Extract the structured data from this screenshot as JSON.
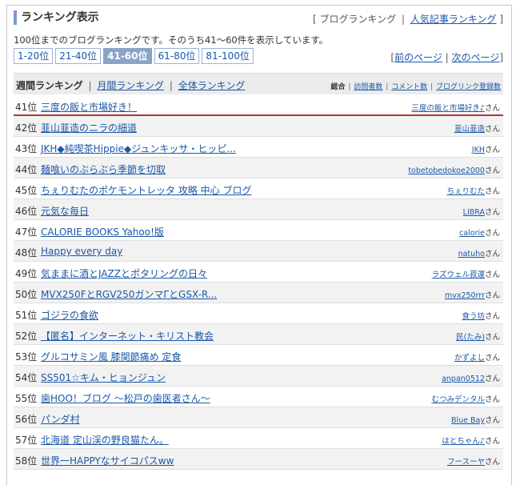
{
  "header": {
    "title": "ランキング表示",
    "bracket_open": "[",
    "blog_ranking": "ブログランキング",
    "sep": "|",
    "popular_ranking": "人気記事ランキング",
    "bracket_close": "]"
  },
  "description": "100位までのブログランキングです。そのうち41～60件を表示しています。",
  "ranges": [
    "1-20位",
    "21-40位",
    "41-60位",
    "61-80位",
    "81-100位"
  ],
  "pager": {
    "open": "[",
    "prev": "前のページ",
    "sep": "|",
    "next": "次のページ",
    "close": "]"
  },
  "period": {
    "weekly": "週間ランキング",
    "sep": "|",
    "monthly": "月間ランキング",
    "overall": "全体ランキング",
    "sort_total": "総合",
    "sort_visitors": "訪問者数",
    "sort_comments": "コメント数",
    "sort_registered": "ブログリンク登録数"
  },
  "suffix": "さん",
  "rows": [
    {
      "rank": "41位",
      "title": "三度の飯と市場好き！",
      "user": "三度の飯と市場好き♪"
    },
    {
      "rank": "42位",
      "title": "韮山韮造のニラの細道",
      "user": "韮山韮造"
    },
    {
      "rank": "43位",
      "title": "JKH◆純喫茶Hippie◆ジュンキッサ・ヒッピ...",
      "user": "JKH"
    },
    {
      "rank": "44位",
      "title": "麺喰いのぶらぶら季節を切取",
      "user": "tobetobedokoe2000"
    },
    {
      "rank": "45位",
      "title": "ちぇりむたのポケモントレッタ 攻略 中心 ブログ",
      "user": "ちぇりむた"
    },
    {
      "rank": "46位",
      "title": "元気な毎日",
      "user": "LIBRA"
    },
    {
      "rank": "47位",
      "title": "CALORIE BOOKS Yahoo!版",
      "user": "calorie"
    },
    {
      "rank": "48位",
      "title": "Happy every day",
      "user": "natuho"
    },
    {
      "rank": "49位",
      "title": "気ままに酒とJAZZとポタリングの日々",
      "user": "ラズウェル菽運"
    },
    {
      "rank": "50位",
      "title": "MVX250FとRGV250ガンマΓとGSX-R...",
      "user": "mvx250rrr"
    },
    {
      "rank": "51位",
      "title": "ゴジラの食欲",
      "user": "食う坊"
    },
    {
      "rank": "52位",
      "title": "【匿名】インターネット・キリスト教会",
      "user": "民(たみ)"
    },
    {
      "rank": "53位",
      "title": "グルコサミン風 膝関節痛め 定食",
      "user": "かずよし"
    },
    {
      "rank": "54位",
      "title": "SS501☆キム・ヒョンジュン",
      "user": "anpan0512"
    },
    {
      "rank": "55位",
      "title": "歯HOO！ブログ ～松戸の歯医者さん～",
      "user": "むつみデンタル"
    },
    {
      "rank": "56位",
      "title": "パンダ村",
      "user": "Blue Bay"
    },
    {
      "rank": "57位",
      "title": "北海道 定山渓の野良猫たん。",
      "user": "はとちゃん♪"
    },
    {
      "rank": "58位",
      "title": "世界一HAPPYなサイコパスww",
      "user": "フースーヤ"
    }
  ]
}
